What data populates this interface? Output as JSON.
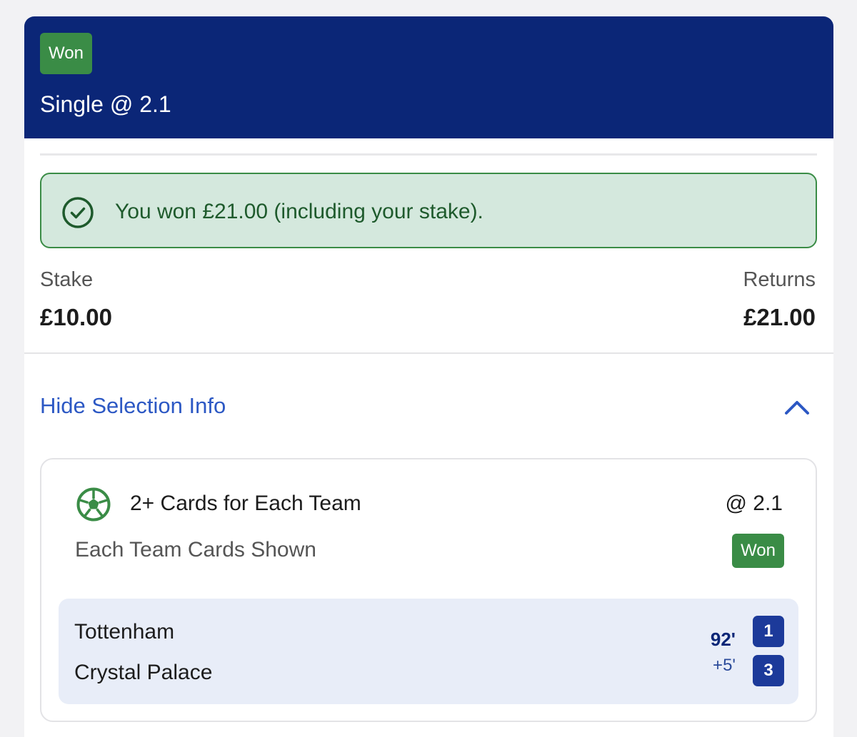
{
  "header": {
    "status_badge": "Won",
    "title": "Single @ 2.1"
  },
  "result_banner": {
    "message": "You won £21.00 (including your stake)."
  },
  "stake": {
    "label": "Stake",
    "value": "£10.00"
  },
  "returns": {
    "label": "Returns",
    "value": "£21.00"
  },
  "selection_toggle": {
    "label": "Hide Selection Info"
  },
  "selection": {
    "market": "2+ Cards for Each Team",
    "odds": "@ 2.1",
    "subtitle": "Each Team Cards Shown",
    "status_badge": "Won",
    "match": {
      "home_team": "Tottenham",
      "away_team": "Crystal Palace",
      "minute": "92'",
      "added_time": "+5'",
      "home_score": "1",
      "away_score": "3"
    }
  },
  "colors": {
    "header_bg": "#0b2677",
    "won_green": "#3a8c46",
    "banner_bg": "#d4e8dd",
    "link_blue": "#2c58c4",
    "score_bg": "#1c3a9a"
  },
  "icons": {
    "banner": "check-circle-icon",
    "toggle": "chevron-up-icon",
    "sport": "football-icon"
  }
}
